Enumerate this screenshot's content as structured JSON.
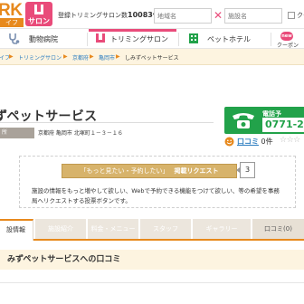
{
  "header": {
    "logo_text": "RK",
    "logo_sub": "イフ",
    "salon_badge": "サロン",
    "count_label": "登録トリミングサロン数",
    "count_value": "10083件",
    "region_placeholder": "地域名",
    "facility_placeholder": "施設名",
    "coupon_label": "クー"
  },
  "nav": {
    "items": [
      {
        "label": "動物病院",
        "color": "#7a8fb0"
      },
      {
        "label": "トリミングサロン",
        "color": "#e94b7a"
      },
      {
        "label": "ペットホテル",
        "color": "#22a24a"
      }
    ],
    "new_badge": "new",
    "coupon": "クーポン"
  },
  "breadcrumbs": [
    "イフ",
    "トリミングサロン",
    "京都府",
    "亀岡市",
    "しみずペットサービス"
  ],
  "shop": {
    "name": "ずペットサービス",
    "address_tag": "所",
    "address": "京都府 亀岡市 北塚町１－３－１６"
  },
  "phone": {
    "label": "電話予",
    "number": "0771-23"
  },
  "reviews": {
    "label": "口コミ",
    "count": "0件",
    "stars": "☆☆☆",
    "rating": 0
  },
  "request": {
    "button_quote": "「もっと見たい・予約したい」",
    "button_action": "掲載リクエスト",
    "count": "3",
    "description": "施設の情報をもっと増やして欲しい、Webで予約できる機能をつけて欲しい、等の希望を事務局へリクエストする投票ボタンです。"
  },
  "tabs": [
    {
      "label": "設情報",
      "active": true
    },
    {
      "label": "施設紹介",
      "active": false
    },
    {
      "label": "料金・メニュー",
      "active": false
    },
    {
      "label": "スタッフ",
      "active": false
    },
    {
      "label": "ギャラリー",
      "active": false
    },
    {
      "label": "口コミ(0)",
      "active": false
    }
  ],
  "section": {
    "title": "みずペットサービスへの口コミ"
  },
  "colors": {
    "brand_orange": "#e7891d",
    "salon_pink": "#e94b7a",
    "phone_green": "#22a24a",
    "link_blue": "#2f7fc1"
  }
}
